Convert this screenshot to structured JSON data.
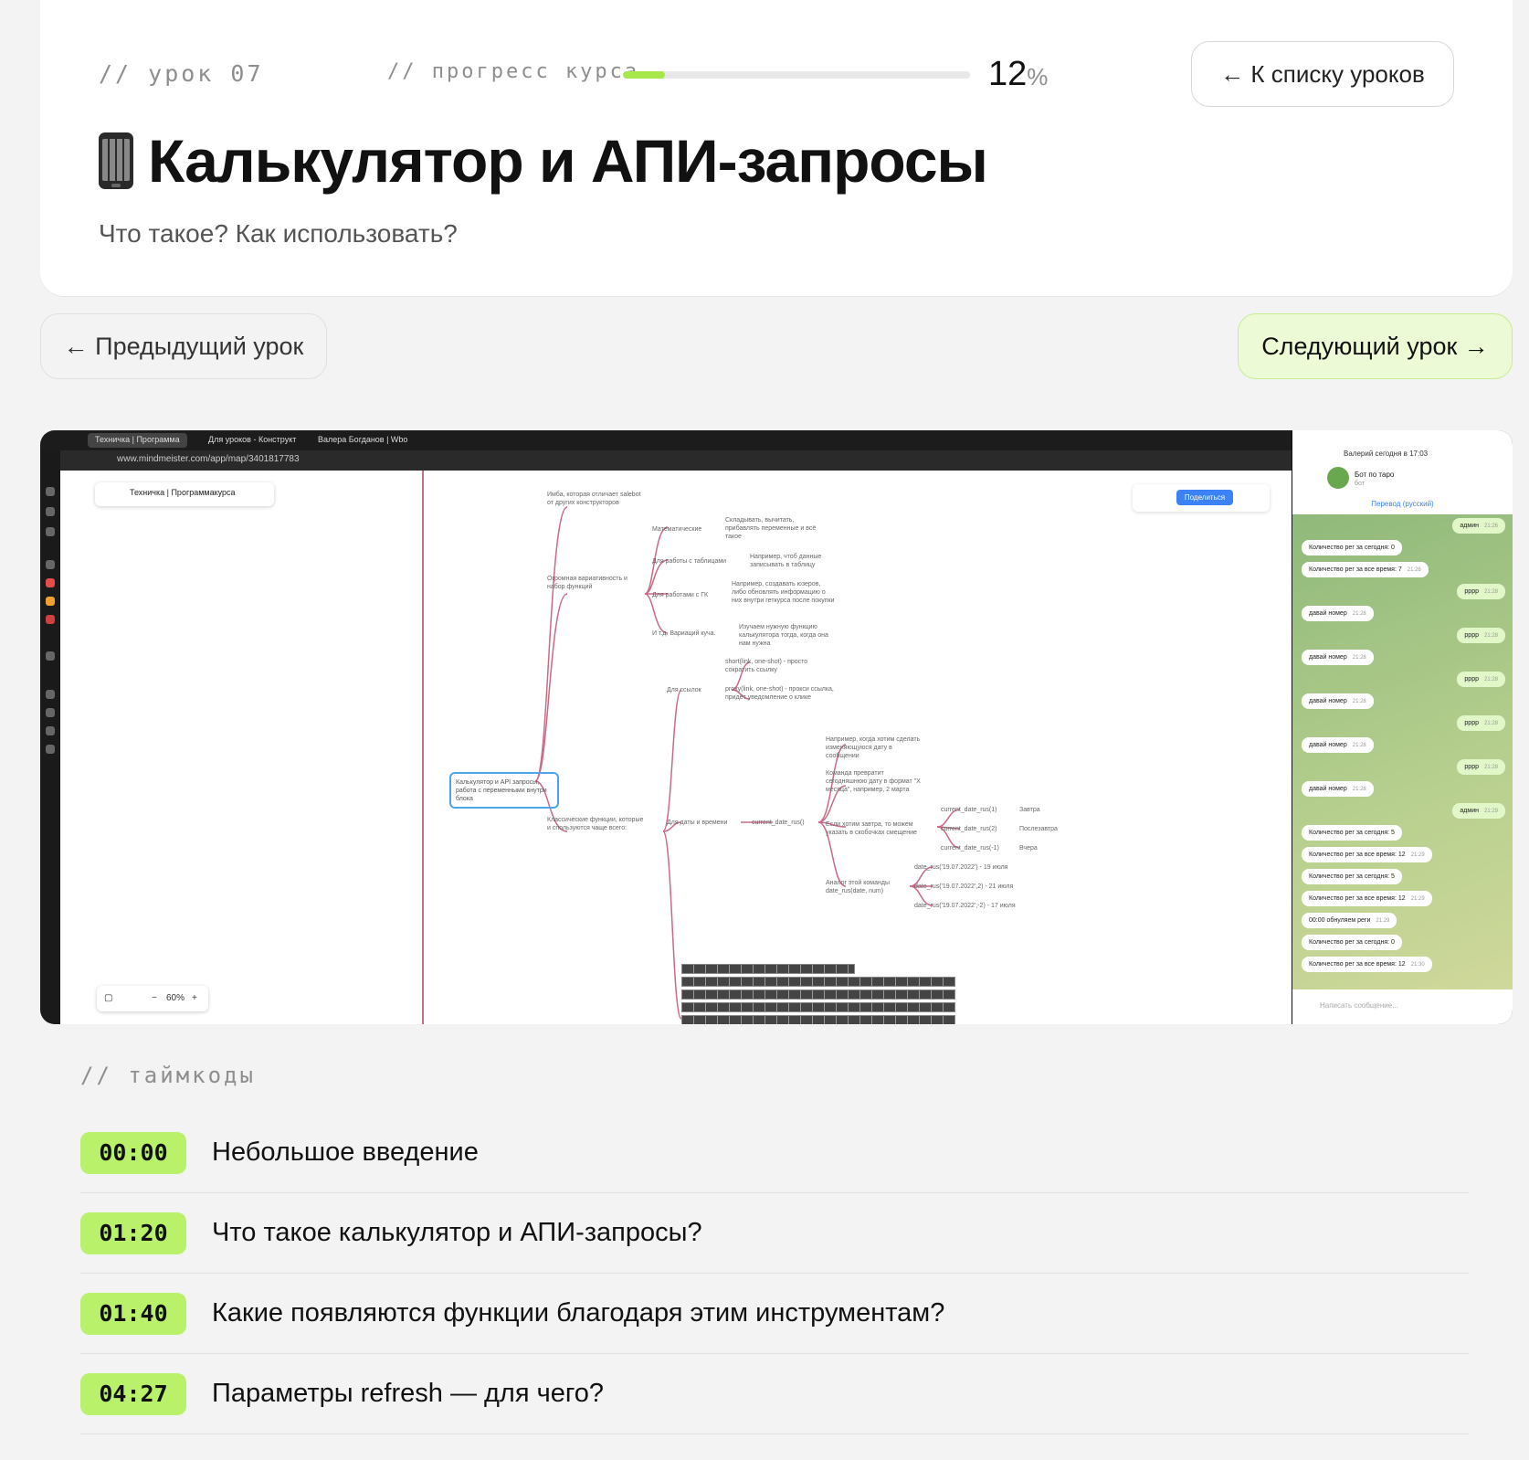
{
  "header": {
    "lesson_number": "// урок 07",
    "progress_label": "// прогресс курса",
    "progress_value": 12,
    "progress_percent_sign": "%",
    "back_to_list": "← К списку уроков",
    "icon": "mobile-phone-icon",
    "title": "Калькулятор и АПИ-запросы",
    "subtitle": "Что такое? Как использовать?"
  },
  "navigation": {
    "prev": "← Предыдущий урок",
    "next": "Следующий урок →"
  },
  "video": {
    "browser_tabs": [
      "Техничка | Программа",
      "Для уроков - Конструкт",
      "Валера Богданов | Wbo"
    ],
    "url": "www.mindmeister.com/app/map/3401817783",
    "map_name": "Техничка | Программакурса",
    "share_button": "Поделиться",
    "zoom": "60%",
    "central_node": "Калькулятор и API запросы, работа с переменными внутри блока",
    "nodes": {
      "n1": "Имба, которая отличает salebot",
      "n1b": "от других конструкторов",
      "n2": "Огромная вариативность и",
      "n2b": "набор функций",
      "n3": "Математические",
      "n3t": "Складывать, вычитать, прибавлять переменные и всё такое",
      "n4": "Для работы с таблицами",
      "n4t": "Например, чтоб данные записывать в таблицу",
      "n5": "Для работами с ГК",
      "n5t": "Например, создавать юзеров, либо обновлять информацию о них внутри геткурса после покупки",
      "n6": "И т.д. Вариаций куча.",
      "n6t": "Изучаем нужную функцию калькулятора тогда, когда она нам нужна",
      "n7": "Для ссылок",
      "n7a": "short(link, one-shot) - просто сократить ссылку",
      "n7b": "proxy(link, one-shot) - прокси ссылка, придёт уведомление о клике",
      "n8": "Классические функции, которые",
      "n8b": "и спользуются чаще всего:",
      "n9": "Для даты и времени",
      "n9f": "current_date_rus()",
      "n10": "Например, когда хотим сделать изменяющуюся дату в сообщении",
      "n11": "Команда превратит сегодняшнюю дату в формат \"Х месяца\", например, 2 марта",
      "n12": "Если хотим завтра, то можем указать в скобочках смещение",
      "n12a": "current_date_rus(1)",
      "n12at": "Завтра",
      "n12b": "current_date_rus(2)",
      "n12bt": "Послезавтра",
      "n12c": "current_date_rus(-1)",
      "n12ct": "Вчера",
      "n13": "Аналог этой команды date_rus(date, num)",
      "n13a": "date_rus('19.07.2022') - 19 июля",
      "n13b": "date_rus('19.07.2022',2) - 21 июля",
      "n13c": "date_rus('19.07.2022',-2) - 17 июля"
    },
    "telegram": {
      "caller": "Валерий сегодня в 17:03",
      "chat_name": "Бот по таро",
      "chat_sub": "бот",
      "translate": "Перевод (русский)",
      "input_placeholder": "Написать сообщение...",
      "messages": [
        {
          "text": "админ",
          "time": "21:26",
          "out": true
        },
        {
          "text": "Количество рег за сегодня: 0",
          "time": "",
          "out": false
        },
        {
          "text": "Количество рег за все время: 7",
          "time": "21:26",
          "out": false
        },
        {
          "text": "рррр",
          "time": "21:28",
          "out": true
        },
        {
          "text": "давай номер",
          "time": "21:28",
          "out": false
        },
        {
          "text": "рррр",
          "time": "21:28",
          "out": true
        },
        {
          "text": "давай номер",
          "time": "21:28",
          "out": false
        },
        {
          "text": "рррр",
          "time": "21:28",
          "out": true
        },
        {
          "text": "давай номер",
          "time": "21:28",
          "out": false
        },
        {
          "text": "рррр",
          "time": "21:28",
          "out": true
        },
        {
          "text": "давай номер",
          "time": "21:28",
          "out": false
        },
        {
          "text": "рррр",
          "time": "21:28",
          "out": true
        },
        {
          "text": "давай номер",
          "time": "21:28",
          "out": false
        },
        {
          "text": "админ",
          "time": "21:29",
          "out": true
        },
        {
          "text": "Количество рег за сегодня: 5",
          "time": "",
          "out": false
        },
        {
          "text": "Количество рег за все время: 12",
          "time": "21:29",
          "out": false
        },
        {
          "text": "Количество рег за сегодня: 5",
          "time": "",
          "out": false
        },
        {
          "text": "Количество рег за все время: 12",
          "time": "21:29",
          "out": false
        },
        {
          "text": "00:00 обнуляем реги",
          "time": "21:29",
          "out": false
        },
        {
          "text": "Количество рег за сегодня: 0",
          "time": "",
          "out": false
        },
        {
          "text": "Количество рег за все время: 12",
          "time": "21:30",
          "out": false
        }
      ]
    }
  },
  "timecodes": {
    "label": "// таймкоды",
    "items": [
      {
        "time": "00:00",
        "title": "Небольшое введение"
      },
      {
        "time": "01:20",
        "title": "Что такое калькулятор и АПИ-запросы?"
      },
      {
        "time": "01:40",
        "title": "Какие появляются функции благодаря этим инструментам?"
      },
      {
        "time": "04:27",
        "title": "Параметры refresh — для чего?"
      }
    ]
  },
  "colors": {
    "accent_green": "#b9f26a",
    "progress_fill": "#a6e84a",
    "next_button_bg": "#ecfad6",
    "mindmap_line": "#c86b85"
  }
}
